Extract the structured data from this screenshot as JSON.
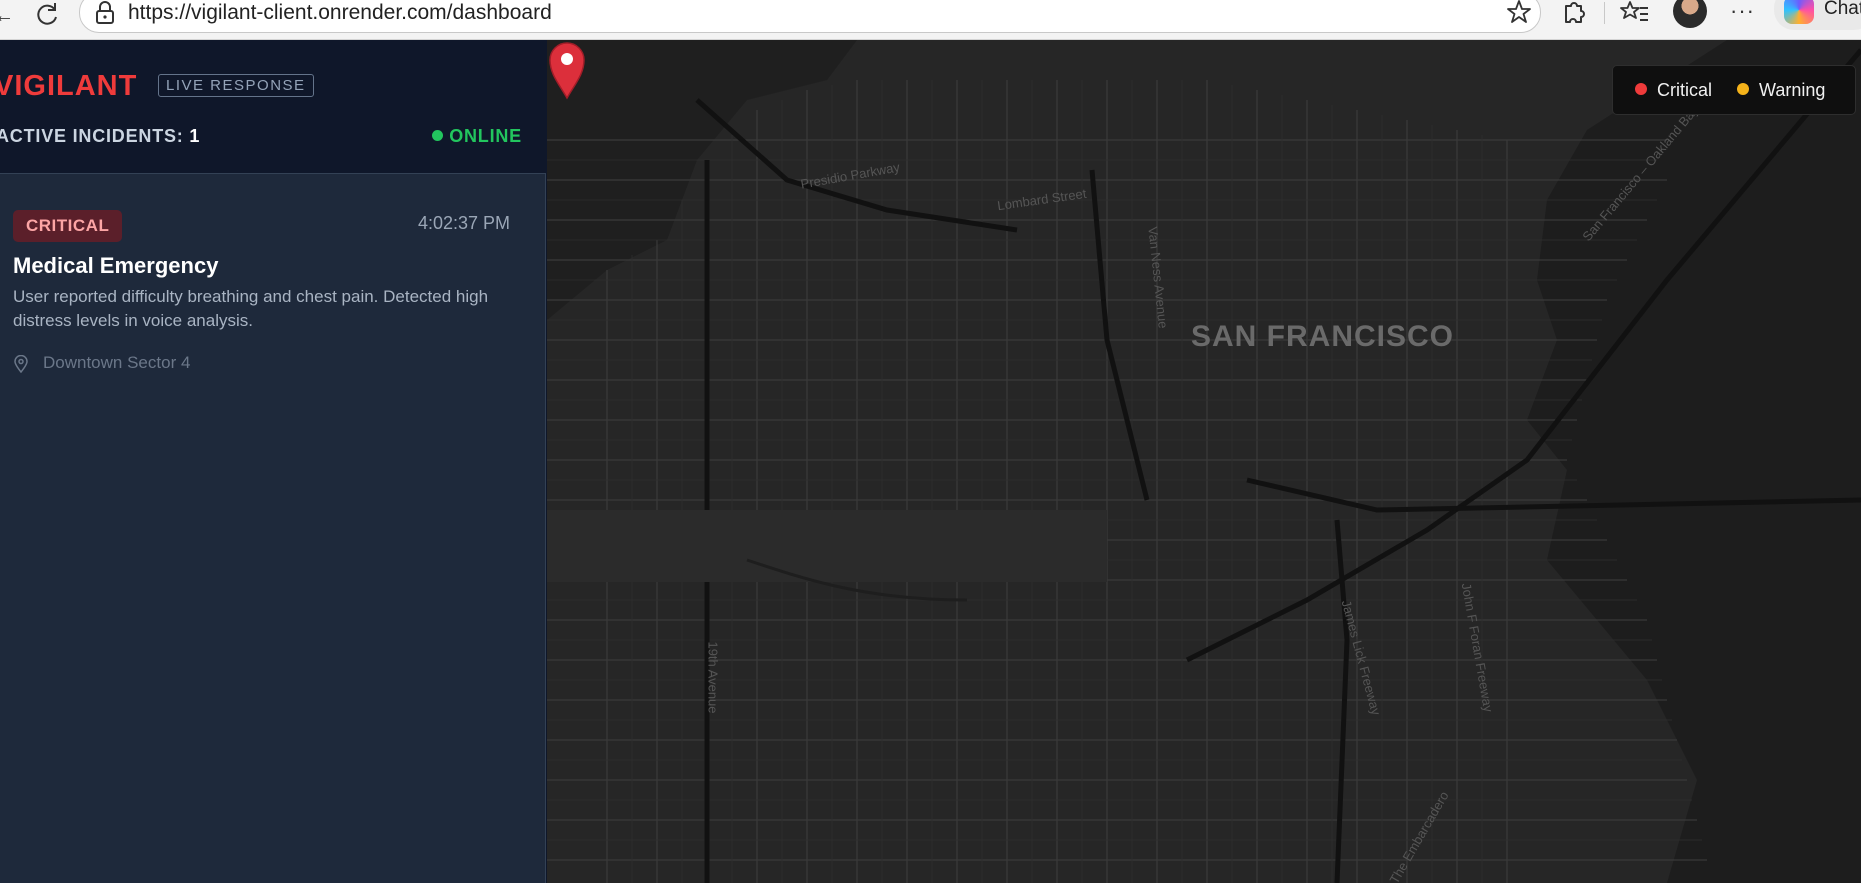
{
  "browser": {
    "url": "https://vigilant-client.onrender.com/dashboard",
    "copilot_label": "Chat",
    "more_label": "···"
  },
  "sidebar": {
    "brand": "VIGILANT",
    "badge": "LIVE RESPONSE",
    "active_label": "ACTIVE INCIDENTS:",
    "active_count": "1",
    "status": "ONLINE",
    "incidents": [
      {
        "severity": "CRITICAL",
        "time": "4:02:37 PM",
        "title": "Medical Emergency",
        "description": "User reported difficulty breathing and chest pain. Detected high distress levels in voice analysis.",
        "location": "Downtown Sector 4"
      }
    ]
  },
  "map": {
    "city_label": "SAN FRANCISCO",
    "streets": [
      "Presidio Parkway",
      "Lombard Street",
      "Van Ness Avenue",
      "19th Avenue",
      "James Lick Freeway",
      "John F Foran Freeway",
      "San Francisco – Oakland Bay Bridge",
      "The Embarcadero"
    ],
    "legend": [
      {
        "label": "Critical",
        "color": "#ef3b3b"
      },
      {
        "label": "Warning",
        "color": "#f5b31a"
      }
    ],
    "marker_color": "#dc2f3b"
  },
  "colors": {
    "accent": "#ef3b3b",
    "online": "#22c55e",
    "sidebar_bg": "#1e293b",
    "header_bg": "#0f172a",
    "map_bg": "#262626"
  }
}
